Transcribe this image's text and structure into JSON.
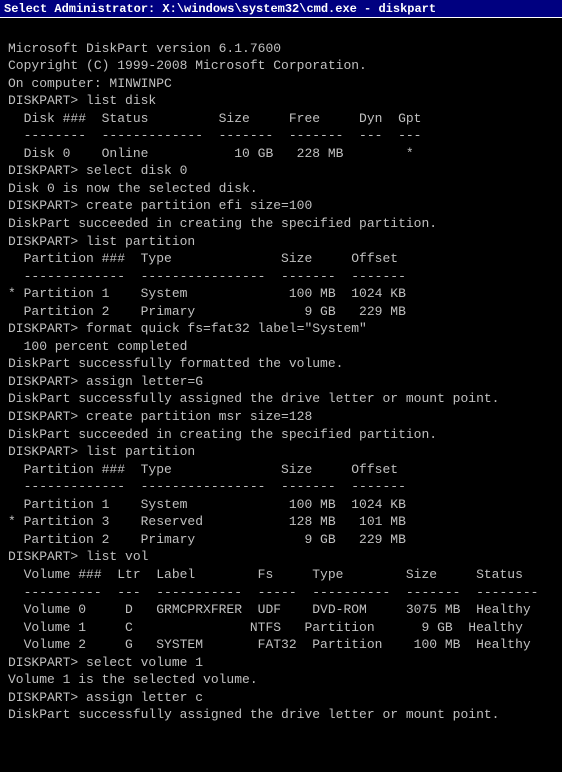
{
  "titleBar": {
    "label": "Select Administrator: X:\\windows\\system32\\cmd.exe - diskpart"
  },
  "terminal": {
    "lines": [
      "Microsoft DiskPart version 6.1.7600",
      "Copyright (C) 1999-2008 Microsoft Corporation.",
      "On computer: MINWINPC",
      "",
      "DISKPART> list disk",
      "",
      "  Disk ###  Status         Size     Free     Dyn  Gpt",
      "  --------  -------------  -------  -------  ---  ---",
      "  Disk 0    Online           10 GB   228 MB        *",
      "",
      "DISKPART> select disk 0",
      "",
      "Disk 0 is now the selected disk.",
      "",
      "DISKPART> create partition efi size=100",
      "",
      "DiskPart succeeded in creating the specified partition.",
      "",
      "DISKPART> list partition",
      "",
      "  Partition ###  Type              Size     Offset",
      "  -------------  ----------------  -------  -------",
      "* Partition 1    System             100 MB  1024 KB",
      "  Partition 2    Primary              9 GB   229 MB",
      "",
      "DISKPART> format quick fs=fat32 label=\"System\"",
      "",
      "  100 percent completed",
      "",
      "DiskPart successfully formatted the volume.",
      "",
      "DISKPART> assign letter=G",
      "",
      "DiskPart successfully assigned the drive letter or mount point.",
      "",
      "DISKPART> create partition msr size=128",
      "",
      "DiskPart succeeded in creating the specified partition.",
      "",
      "DISKPART> list partition",
      "",
      "  Partition ###  Type              Size     Offset",
      "  -------------  ----------------  -------  -------",
      "  Partition 1    System             100 MB  1024 KB",
      "* Partition 3    Reserved           128 MB   101 MB",
      "  Partition 2    Primary              9 GB   229 MB",
      "",
      "DISKPART> list vol",
      "",
      "  Volume ###  Ltr  Label        Fs     Type        Size     Status",
      "  ----------  ---  -----------  -----  ----------  -------  --------",
      "  Volume 0     D   GRMCPRXFRER  UDF    DVD-ROM     3075 MB  Healthy",
      "  Volume 1     C               NTFS   Partition      9 GB  Healthy",
      "  Volume 2     G   SYSTEM       FAT32  Partition    100 MB  Healthy",
      "",
      "DISKPART> select volume 1",
      "",
      "Volume 1 is the selected volume.",
      "",
      "DISKPART> assign letter c",
      "",
      "DiskPart successfully assigned the drive letter or mount point."
    ]
  }
}
